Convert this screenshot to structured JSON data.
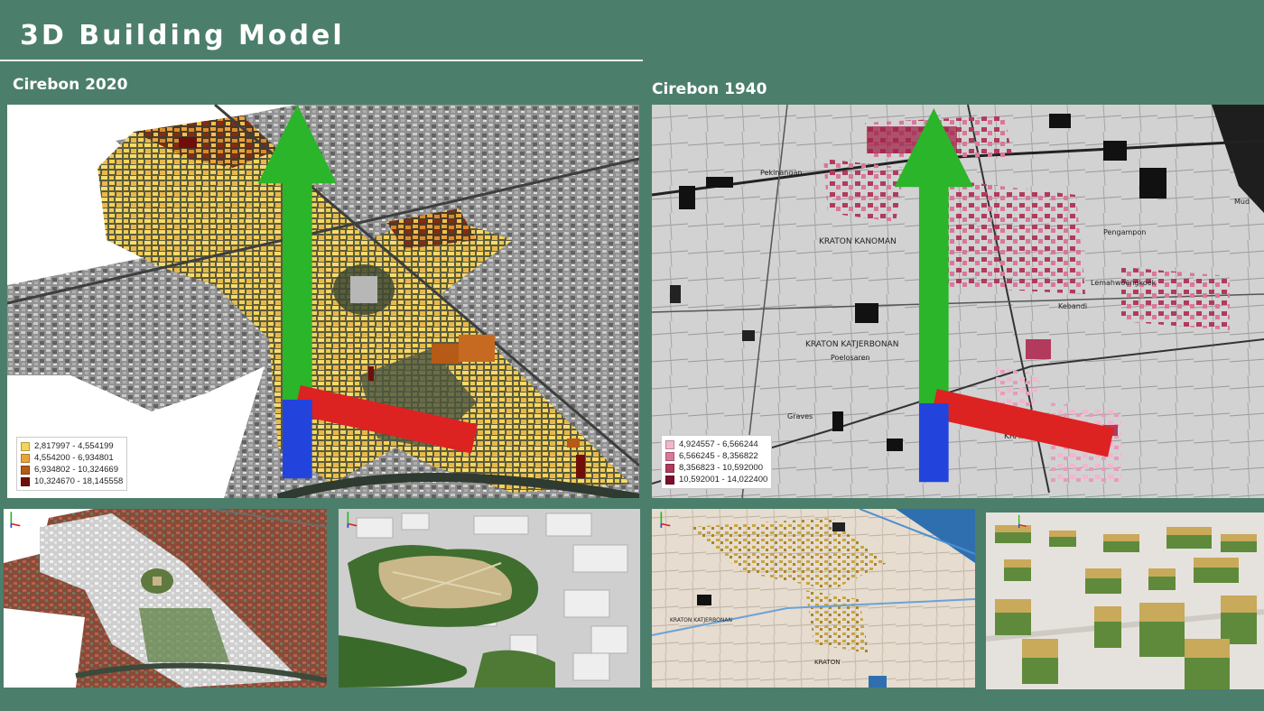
{
  "header": {
    "title": "3D Building Model"
  },
  "panels": {
    "left_main": {
      "label": "Cirebon 2020",
      "legend": [
        {
          "range": "2,817997 - 4,554199",
          "color": "#f3d35a"
        },
        {
          "range": "4,554200 - 6,934801",
          "color": "#e9a43a"
        },
        {
          "range": "6,934802 - 10,324669",
          "color": "#b55a17"
        },
        {
          "range": "10,324670 - 18,145558",
          "color": "#6e0f0b"
        }
      ]
    },
    "right_main": {
      "label": "Cirebon 1940",
      "legend": [
        {
          "range": "4,924557 - 6,566244",
          "color": "#f2b6cf"
        },
        {
          "range": "6,566245 - 8,356822",
          "color": "#d9779a"
        },
        {
          "range": "8,356823 - 10,592000",
          "color": "#b23a5c"
        },
        {
          "range": "10,592001 - 14,022400",
          "color": "#7c0f2b"
        }
      ],
      "map_labels": [
        "Pekinangan",
        "KRATON KANOMAN",
        "KRATON KATJERBONAN",
        "Poelosaren",
        "Graves",
        "Lemahwoengkoek",
        "Kebandi",
        "KRATON",
        "KASEPOEHAN",
        "Pengampon",
        "Mud"
      ]
    },
    "thumbnails": [
      {
        "name": "thumb-2020-textured-overview"
      },
      {
        "name": "thumb-2020-alun-alun-closeup"
      },
      {
        "name": "thumb-1940-historic-overview"
      },
      {
        "name": "thumb-1940-block-closeup"
      }
    ]
  },
  "colors": {
    "background": "#4c7e6c",
    "title_rule": "#e8eee9"
  }
}
